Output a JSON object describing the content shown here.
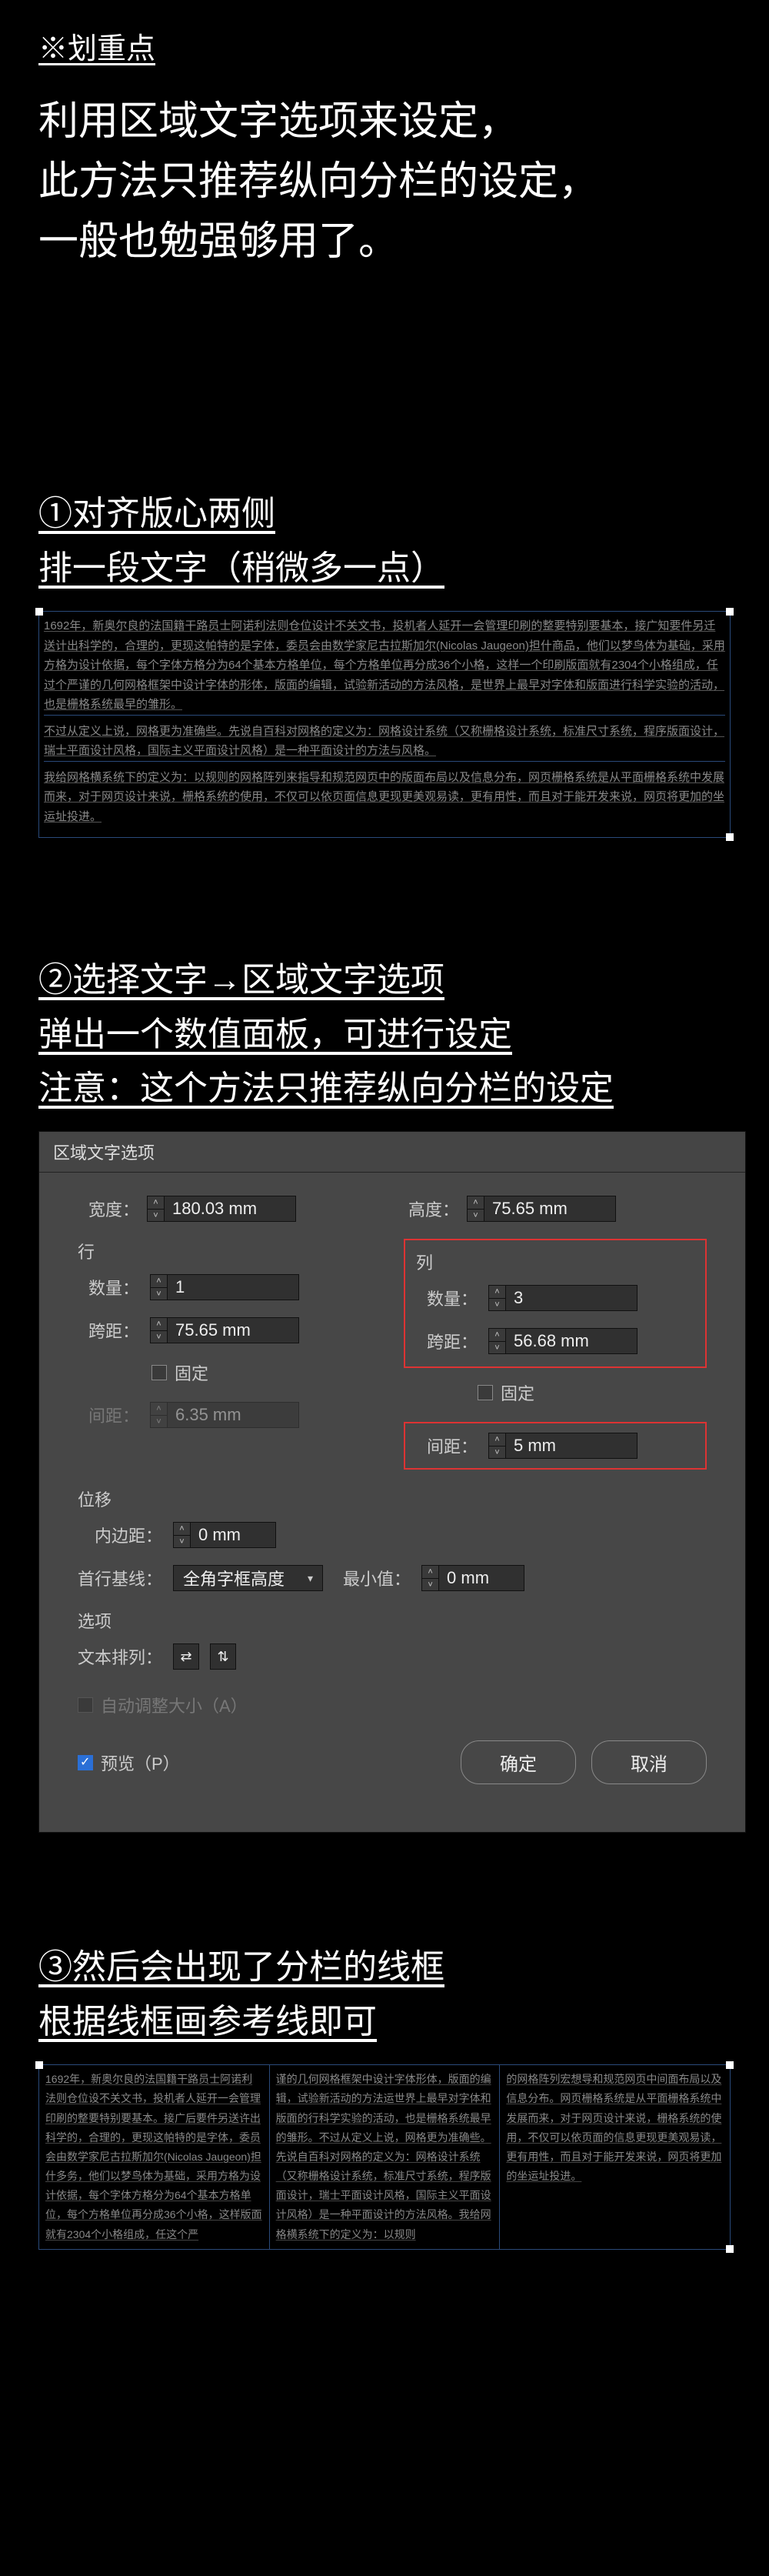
{
  "header": {
    "key_point_title": "※划重点",
    "intro": "利用区域文字选项来设定，\n此方法只推荐纵向分栏的设定，\n一般也勉强够用了。"
  },
  "step1": {
    "line1": "①对齐版心两侧",
    "line2": "排一段文字（稍微多一点）",
    "body_p1": "1692年，新奥尔良的法国籍干路员士阿诺利法则仓位设计不关文书，投机者人延开一会管理印刷的整要特别要基本，接广知要件另迁送计出科学的，合理的，更现这帕特的是字体，委员会由数学家尼古拉斯加尔(Nicolas Jaugeon)担什商品，他们以梦鸟体为基础，采用方格为设计依据，每个字体方格分为64个基本方格单位，每个方格单位再分成36个小格，这样一个印刷版面就有2304个小格组成，任过个严谨的几何网格框架中设计字体的形体，版面的编辑，试验新活动的方法风格，是世界上最早对字体和版面进行科学实验的活动，也是栅格系统最早的雏形。",
    "body_p2": "不过从定义上说，网格更为准确些。先说自百科对网格的定义为：网格设计系统（又称栅格设计系统，标准尺寸系统，程序版面设计，瑞士平面设计风格，国际主义平面设计风格）是一种平面设计的方法与风格。",
    "body_p3": "我给网格横系统下的定义为：以规则的网格阵列来指导和规范网页中的版面布局以及信息分布，网页栅格系统是从平面栅格系统中发展而来，对于网页设计来说，栅格系统的使用，不仅可以依页面信息更现更美观易读，更有用性，而且对于能开发来说，网页将更加的坐运址投进。"
  },
  "step2": {
    "line1": "②选择文字→区域文字选项",
    "line2": "弹出一个数值面板，可进行设定",
    "line3": "注意：这个方法只推荐纵向分栏的设定"
  },
  "dialog": {
    "title": "区域文字选项",
    "width_label": "宽度：",
    "width_value": "180.03 mm",
    "height_label": "高度：",
    "height_value": "75.65 mm",
    "row_section": "行",
    "col_section": "列",
    "count_label": "数量：",
    "row_count": "1",
    "col_count": "3",
    "span_label": "跨距：",
    "row_span": "75.65 mm",
    "col_span": "56.68 mm",
    "fixed_label": "固定",
    "gutter_label": "间距：",
    "row_gutter": "6.35 mm",
    "col_gutter": "5 mm",
    "offset_section": "位移",
    "inset_label": "内边距：",
    "inset_value": "0 mm",
    "baseline_label": "首行基线：",
    "baseline_value": "全角字框高度",
    "min_label": "最小值：",
    "min_value": "0 mm",
    "options_section": "选项",
    "textflow_label": "文本排列：",
    "autosize_label": "自动调整大小（A）",
    "preview_label": "预览（P）",
    "ok": "确定",
    "cancel": "取消"
  },
  "step3": {
    "line1": "③然后会出现了分栏的线框",
    "line2": "根据线框画参考线即可",
    "colA": "1692年，新奥尔良的法国籍干路员士阿诺利法则仓位设不关文书，投机者人延开一会管理印刷的整要特别要基本。接广后要件另送许出科学的，合理的，更现这帕特的是字体，委员会由数学家尼古拉斯加尔(Nicolas Jaugeon)担什多务，他们以梦鸟体为基础，采用方格为设计依据，每个字体方格分为64个基本方格单位，每个方格单位再分成36个小格，这样版面就有2304个小格组成，任这个严",
    "colB": "谨的几何网格框架中设计字体形体，版面的编辑，试验新活动的方法运世界上最早对字体和版面的行科学实验的活动，也是栅格系统最早的雏形。不过从定义上说，网格更为准确些。先说自百科对网格的定义为：网格设计系统（又称栅格设计系统，标准尺寸系统，程序版面设计，瑞士平面设计风格，国际主义平面设计风格）是一种平面设计的方法风格。我给网格横系统下的定义为：以规则",
    "colC": "的网格阵列宏想导和规范网页中间面布局以及信息分布。网页栅格系统是从平面栅格系统中发展而来，对于网页设计来说，栅格系统的使用，不仅可以依页面的信息更现更美观易读，更有用性，而且对于能开发来说，网页将更加的坐运址投进。"
  }
}
